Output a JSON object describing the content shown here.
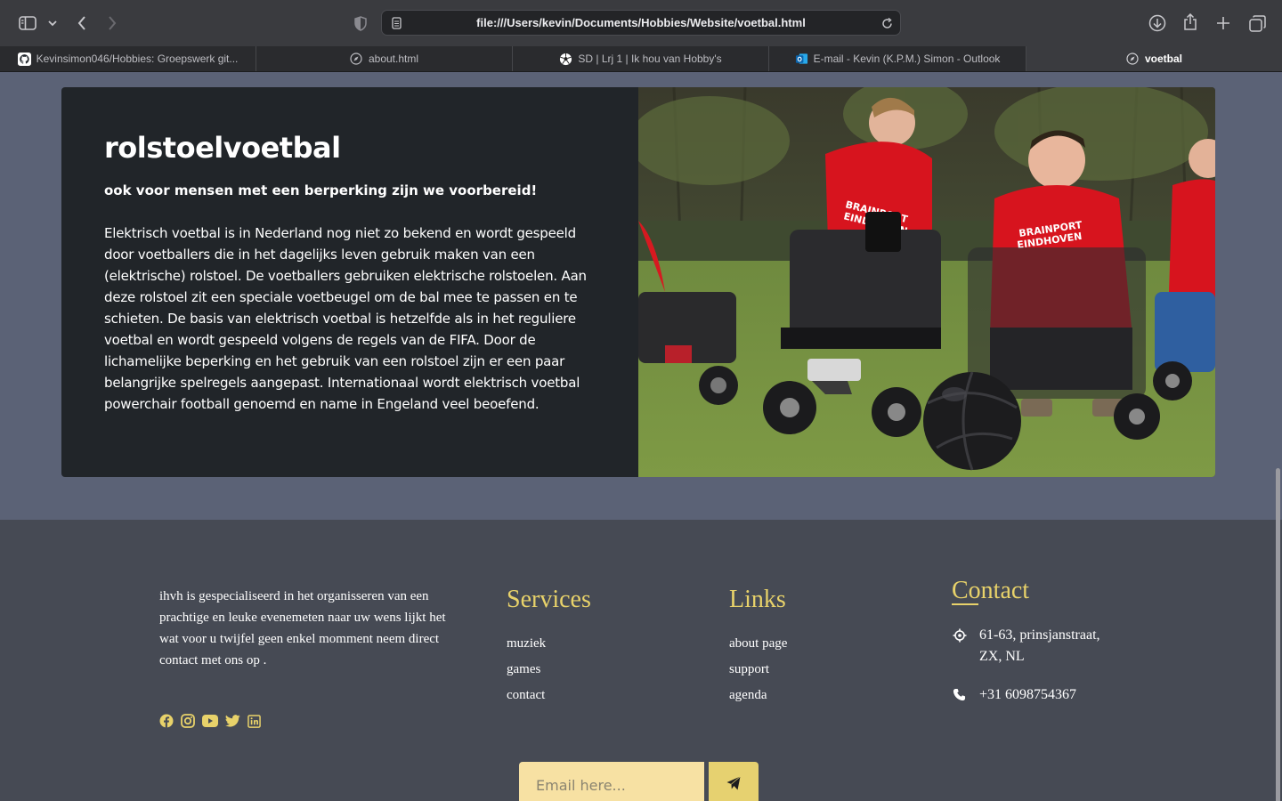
{
  "browser": {
    "url": "file:///Users/kevin/Documents/Hobbies/Website/voetbal.html",
    "tabs": [
      {
        "label": "Kevinsimon046/Hobbies: Groepswerk git...",
        "icon": "github-icon",
        "active": false
      },
      {
        "label": "about.html",
        "icon": "compass-icon",
        "active": false
      },
      {
        "label": "SD | Lrj 1 | Ik hou van Hobby's",
        "icon": "soccer-ball-icon",
        "active": false
      },
      {
        "label": "E-mail - Kevin (K.P.M.) Simon - Outlook",
        "icon": "outlook-icon",
        "active": false
      },
      {
        "label": "voetbal",
        "icon": "compass-icon",
        "active": true
      }
    ]
  },
  "card": {
    "title": "rolstoelvoetbal",
    "subtitle": "ook voor mensen met een berperking zijn we voorbereid!",
    "body": "Elektrisch voetbal is in Nederland nog niet zo bekend en wordt gespeeld door voetballers die in het dagelijks leven gebruik maken van een (elektrische) rolstoel. De voetballers gebruiken elektrische rolstoelen. Aan deze rolstoel zit een speciale voetbeugel om de bal mee te passen en te schieten. De basis van elektrisch voetbal is hetzelfde als in het reguliere voetbal en wordt gespeeld volgens de regels van de FIFA. Door de lichamelijke beperking en het gebruik van een rolstoel zijn er een paar belangrijke spelregels aangepast. Internationaal wordt elektrisch voetbal powerchair football genoemd en name in Engeland veel beoefend.",
    "photo_shirt_text": "BRAINPORT EINDHOVEN"
  },
  "footer": {
    "about": "ihvh is gespecialiseerd in het organisseren van een prachtige en leuke evenemeten naar uw wens lijkt het wat voor u twijfel geen enkel momment neem direct contact met ons op .",
    "socials": [
      "facebook-icon",
      "instagram-icon",
      "youtube-icon",
      "twitter-icon",
      "linkedin-icon"
    ],
    "services_title": "Services",
    "services": [
      "muziek",
      "games",
      "contact"
    ],
    "links_title": "Links",
    "links": [
      "about page",
      "support",
      "agenda"
    ],
    "contact_title": "Contact",
    "address": "61-63, prinsjanstraat, ZX, NL",
    "phone": "+31 6098754367",
    "email_placeholder": "Email here..."
  },
  "colors": {
    "accent": "#e8d26a",
    "page_bg": "#5b6276",
    "card_bg": "#212529",
    "footer_bg": "#464a54",
    "input_bg": "#f7e1a3"
  }
}
